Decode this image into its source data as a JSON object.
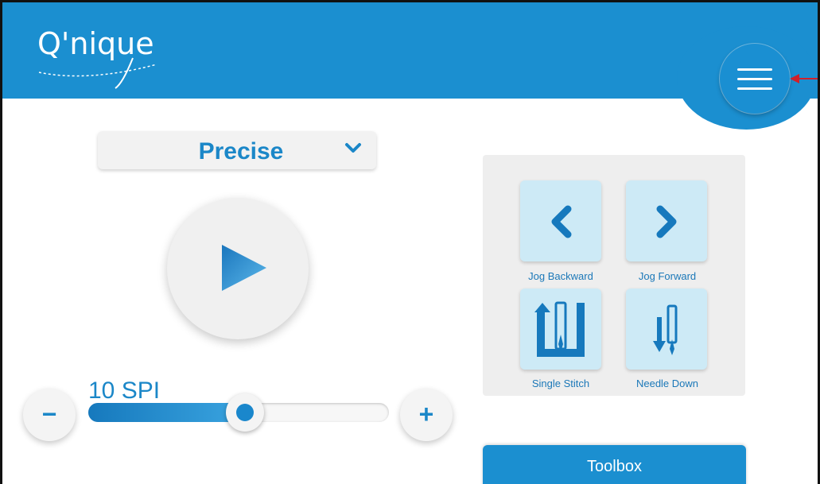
{
  "app": {
    "logo_text": "Q'nique",
    "brand_color": "#1b8fd0"
  },
  "header": {
    "menu_icon": "hamburger-menu-icon"
  },
  "mode": {
    "selected": "Precise",
    "icon": "chevron-down-icon"
  },
  "play": {
    "icon": "play-icon"
  },
  "speed": {
    "label": "10 SPI",
    "value_fraction": 0.5,
    "decrease_label": "−",
    "increase_label": "+"
  },
  "jog": {
    "buttons": [
      {
        "label": "Jog Backward",
        "icon": "chevron-left-icon"
      },
      {
        "label": "Jog Forward",
        "icon": "chevron-right-icon"
      },
      {
        "label": "Single Stitch",
        "icon": "single-stitch-icon"
      },
      {
        "label": "Needle Down",
        "icon": "needle-down-icon"
      }
    ]
  },
  "toolbox": {
    "label": "Toolbox"
  }
}
